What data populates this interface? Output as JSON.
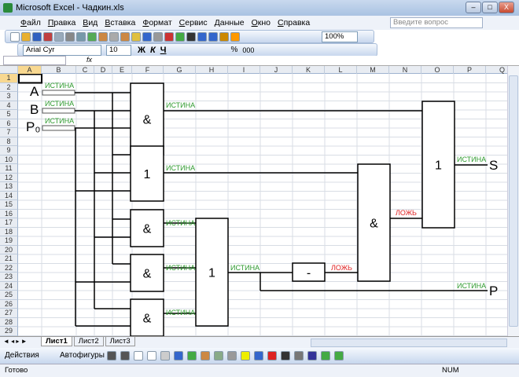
{
  "window": {
    "title": "Microsoft Excel - Чадкин.xls",
    "min": "–",
    "max": "□",
    "close": "X"
  },
  "menu": [
    "Файл",
    "Правка",
    "Вид",
    "Вставка",
    "Формат",
    "Сервис",
    "Данные",
    "Окно",
    "Справка"
  ],
  "help_placeholder": "Введите вопрос",
  "toolbar": {
    "zoom": "100%",
    "font": "Arial Cyr",
    "size": "10",
    "bold": "Ж",
    "italic": "К",
    "underline": "Ч",
    "percent": "%",
    "thousands": "000"
  },
  "formula": {
    "name_box": "",
    "fx": "fx"
  },
  "columns": [
    "A",
    "B",
    "C",
    "D",
    "E",
    "F",
    "G",
    "H",
    "I",
    "J",
    "K",
    "L",
    "M",
    "N",
    "O",
    "P",
    "Q"
  ],
  "rows": 29,
  "circuit": {
    "inputs": [
      "A",
      "B",
      "P₀"
    ],
    "input_values": [
      "ИСТИНА",
      "ИСТИНА",
      "ИСТИНА"
    ],
    "gates": [
      "&",
      "1",
      "&",
      "&",
      "&",
      "1",
      "-",
      "&",
      "1"
    ],
    "values": {
      "g1": "ИСТИНА",
      "g2": "ИСТИНА",
      "g3": "ИСТИНА",
      "g4": "ИСТИНА",
      "g5": "ИСТИНА",
      "or2": "ИСТИНА",
      "not": "ЛОЖЬ",
      "and2": "ЛОЖЬ",
      "s": "ИСТИНА",
      "p": "ИСТИНА"
    },
    "outputs": [
      "S",
      "P"
    ]
  },
  "colors": {
    "true": "#2e9a2e",
    "false": "#e02020"
  },
  "sheets": [
    "Лист1",
    "Лист2",
    "Лист3"
  ],
  "drawbar": {
    "actions": "Действия",
    "autoshapes": "Автофигуры"
  },
  "status": {
    "ready": "Готово",
    "num": "NUM"
  }
}
